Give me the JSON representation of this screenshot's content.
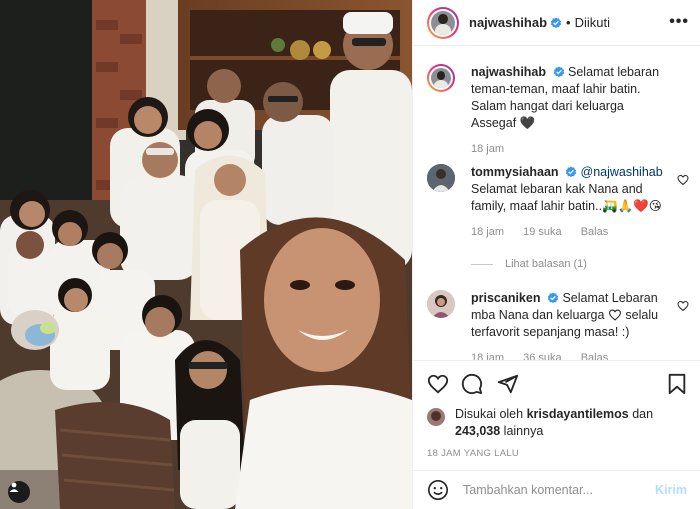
{
  "post": {
    "username": "najwashihab",
    "follow_status": "Diikuti",
    "separator": "•",
    "more_label": "•••"
  },
  "comments": [
    {
      "username": "najwashihab",
      "text": "Selamat lebaran teman-teman, maaf lahir batin. Salam hangat dari keluarga Assegaf",
      "emoji": "🖤",
      "time": "18 jam"
    },
    {
      "username": "tommysiahaan",
      "mention": "@najwashihab",
      "text": "Selamat lebaran kak Nana and family, maaf lahir batin..",
      "emoji": "🛺🙏❤️😘",
      "time": "18 jam",
      "likes": "19 suka",
      "reply": "Balas",
      "view_replies": "Lihat balasan (1)"
    },
    {
      "username": "priscaniken",
      "text_before": "Selamat Lebaran mba Nana dan keluarga",
      "text_after": "selalu terfavorit sepanjang masa! :)",
      "time": "18 jam",
      "likes": "36 suka",
      "reply": "Balas"
    }
  ],
  "likes": {
    "prefix": "Disukai oleh",
    "user": "krisdayantilemos",
    "joiner": "dan",
    "count": "243,038",
    "suffix": "lainnya"
  },
  "timestamp": "18 JAM YANG LALU",
  "add_comment": {
    "placeholder": "Tambahkan komentar...",
    "post_label": "Kirim"
  },
  "icons": [
    "heart-icon",
    "comment-icon",
    "share-icon",
    "bookmark-icon",
    "emoji-icon",
    "verified-icon",
    "user-tag-icon"
  ],
  "colors": {
    "verified": "#3897f0",
    "link": "#00376b",
    "muted": "#8e8e8e",
    "post_disabled": "#b2dffc"
  }
}
